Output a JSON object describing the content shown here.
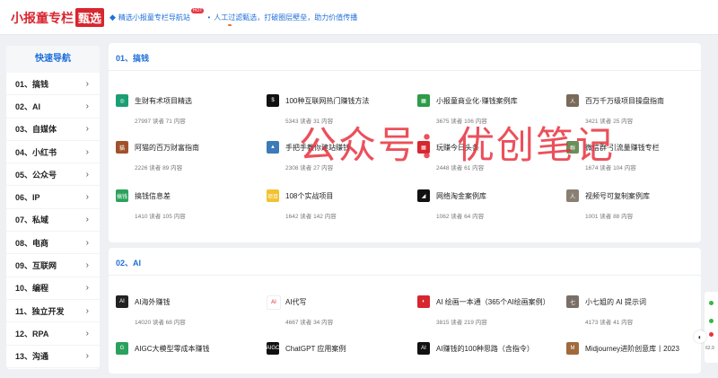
{
  "header": {
    "logo_text": "小报童专栏",
    "logo_badge": "甄选",
    "notice_1": "精选小报童专栏导航站",
    "hot_badge": "HOT",
    "notice_2": "人工过滤甄选，打破圈层壁垒，助力价值传播"
  },
  "sidebar": {
    "title": "快速导航",
    "items": [
      {
        "label": "01、搞钱"
      },
      {
        "label": "02、AI"
      },
      {
        "label": "03、自媒体"
      },
      {
        "label": "04、小红书"
      },
      {
        "label": "05、公众号"
      },
      {
        "label": "06、IP"
      },
      {
        "label": "07、私域"
      },
      {
        "label": "08、电商"
      },
      {
        "label": "09、互联网"
      },
      {
        "label": "10、编程"
      },
      {
        "label": "11、独立开发"
      },
      {
        "label": "12、RPA"
      },
      {
        "label": "13、沟通"
      }
    ]
  },
  "sections": [
    {
      "title": "01、搞钱",
      "items": [
        {
          "name": "生财有术项目精选",
          "meta": "27997 读者 71 内容",
          "icon": "ring-icon",
          "color": "#1a9e74",
          "glyph": "◎"
        },
        {
          "name": "100种互联网热门赚钱方法",
          "meta": "5343 读者 31 内容",
          "icon": "dark-square-icon",
          "color": "#111111",
          "glyph": "$"
        },
        {
          "name": "小报童商业化·赚钱案例库",
          "meta": "3675 读者 106 内容",
          "icon": "green-grid-icon",
          "color": "#2e9b47",
          "glyph": "▦"
        },
        {
          "name": "百万千万级项目操盘指南",
          "meta": "3421 读者 25 内容",
          "icon": "portrait-icon",
          "color": "#7a6a5a",
          "glyph": "人"
        },
        {
          "name": "阿猫的百万财富指南",
          "meta": "2226 读者 89 内容",
          "icon": "cat-avatar-icon",
          "color": "#a0522d",
          "glyph": "猫"
        },
        {
          "name": "手把手教你建站赚钱",
          "meta": "2308 读者 27 内容",
          "icon": "landscape-icon",
          "color": "#3d7ab8",
          "glyph": "▲"
        },
        {
          "name": "玩赚今日头条",
          "meta": "2448 读者 61 内容",
          "icon": "red-grid-icon",
          "color": "#d8262f",
          "glyph": "▦"
        },
        {
          "name": "微信群·引流量赚钱专栏",
          "meta": "1674 读者 104 内容",
          "icon": "photo-icon",
          "color": "#6b8e5a",
          "glyph": "群"
        },
        {
          "name": "搞钱信息差",
          "meta": "1410 读者 105 内容",
          "icon": "green-text-icon",
          "color": "#2aa15d",
          "glyph": "搞钱"
        },
        {
          "name": "108个实战项目",
          "meta": "1642 读者 142 内容",
          "icon": "yellow-label-icon",
          "color": "#f2c230",
          "glyph": "项目"
        },
        {
          "name": "网络淘金案例库",
          "meta": "1062 读者 64 内容",
          "icon": "black-mark-icon",
          "color": "#111111",
          "glyph": "◢"
        },
        {
          "name": "视频号可复制案例库",
          "meta": "1001 读者 88 内容",
          "icon": "person-icon",
          "color": "#8a7f73",
          "glyph": "人"
        }
      ]
    },
    {
      "title": "02、AI",
      "items": [
        {
          "name": "AI海外赚钱",
          "meta": "14020 读者 68 内容",
          "icon": "robot-icon",
          "color": "#222222",
          "glyph": "AI"
        },
        {
          "name": "AI代写",
          "meta": "4667 读者 34 内容",
          "icon": "ai-text-icon",
          "color": "#ffffff",
          "glyph": "AI"
        },
        {
          "name": "AI 绘画一本通（365个AI绘画案例）",
          "meta": "3815 读者 219 内容",
          "icon": "red-circle-icon",
          "color": "#d8262f",
          "glyph": "◐"
        },
        {
          "name": "小七姐的 AI 提示词",
          "meta": "4173 读者 41 内容",
          "icon": "avatar-icon",
          "color": "#7a6f66",
          "glyph": "七"
        },
        {
          "name": "AIGC大模型零成本赚钱",
          "meta": "",
          "icon": "green-square-icon",
          "color": "#2aa15d",
          "glyph": "G"
        },
        {
          "name": "ChatGPT 应用案例",
          "meta": "",
          "icon": "aigc-icon",
          "color": "#111111",
          "glyph": "AIGC"
        },
        {
          "name": "AI赚钱的100种思路（含指令）",
          "meta": "",
          "icon": "ai-black-icon",
          "color": "#111111",
          "glyph": "AI"
        },
        {
          "name": "Midjourney进阶创意库丨2023",
          "meta": "",
          "icon": "art-icon",
          "color": "#a06a3a",
          "glyph": "M"
        }
      ]
    }
  ],
  "watermark": "公众号：优创笔记",
  "rightbar": {
    "label": "62.9"
  }
}
